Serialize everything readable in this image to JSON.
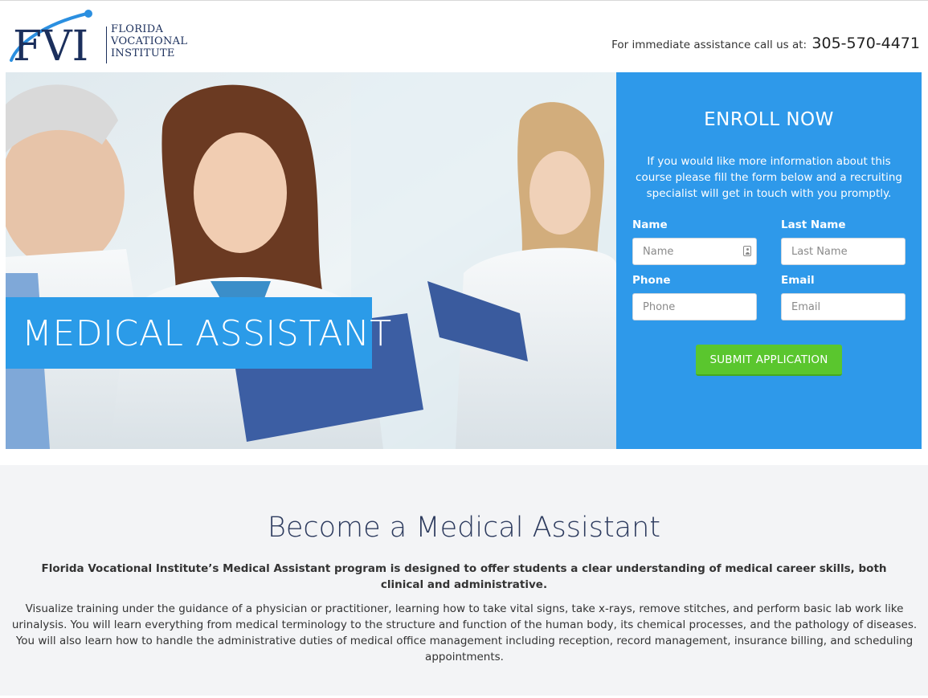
{
  "brand": {
    "logo_letters": "FVI",
    "logo_line1": "FLORIDA",
    "logo_line2": "VOCATIONAL",
    "logo_line3": "INSTITUTE"
  },
  "header": {
    "assist_text": "For immediate assistance call us at:",
    "phone": "305-570-4471"
  },
  "hero": {
    "title": "MEDICAL ASSISTANT"
  },
  "enroll": {
    "title": "ENROLL NOW",
    "description": "If you would like more information about this course please fill the form below and a recruiting specialist will get in touch with you promptly.",
    "fields": {
      "name": {
        "label": "Name",
        "placeholder": "Name"
      },
      "last_name": {
        "label": "Last Name",
        "placeholder": "Last Name"
      },
      "phone": {
        "label": "Phone",
        "placeholder": "Phone"
      },
      "email": {
        "label": "Email",
        "placeholder": "Email"
      }
    },
    "submit_label": "SUBMIT APPLICATION"
  },
  "about": {
    "title": "Become a Medical Assistant",
    "lead": "Florida Vocational Institute’s Medical Assistant program is designed to offer students a clear understanding of medical career skills, both clinical and administrative.",
    "body": "Visualize training under the guidance of a physician or practitioner, learning how to take vital signs, take x-rays, remove stitches, and perform basic lab work like urinalysis. You will learn everything from medical terminology to the structure and function of the human body, its chemical processes, and the pathology of diseases. You will also learn how to handle the administrative duties of medical office management including reception, record management, insurance billing, and scheduling appointments."
  },
  "colors": {
    "brand_navy": "#1b2f5c",
    "brand_blue": "#2e99ea",
    "submit_green": "#5ac62e",
    "section_bg": "#f3f4f6"
  }
}
